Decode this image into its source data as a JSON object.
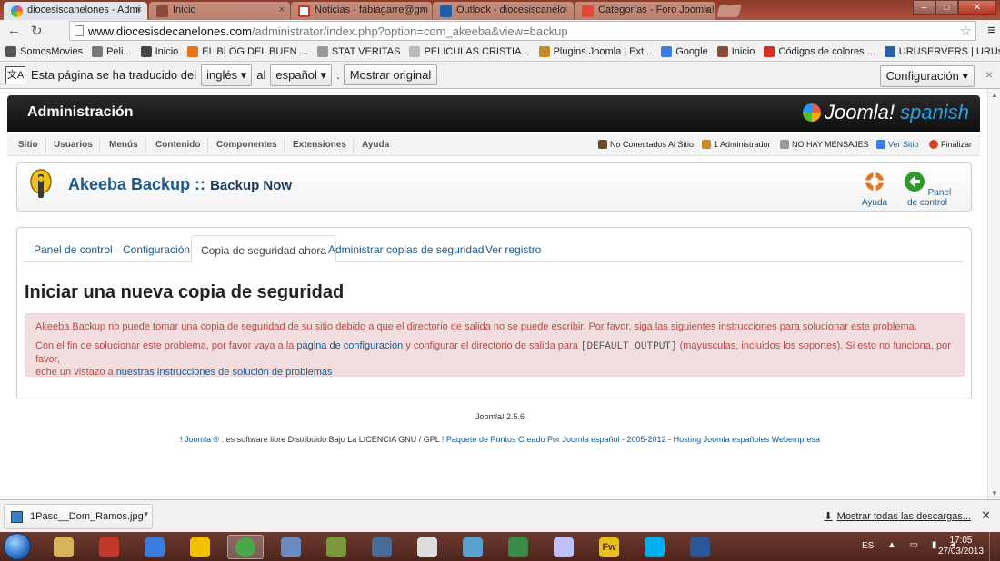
{
  "browser": {
    "tabs": [
      {
        "title": "diocesiscanelones - Admi",
        "close": "×",
        "color": "#2a6fc4"
      },
      {
        "title": "Inicio",
        "close": "×",
        "color": "#8b4a3a"
      },
      {
        "title": "Noticias - fabiagarre@gm",
        "close": "×",
        "color": "#d93025"
      },
      {
        "title": "Outlook - diocesiscanelo",
        "close": "×",
        "color": "#1f5fa8"
      },
      {
        "title": "Categorías - Foro Joomla!",
        "close": "×",
        "color": "#e04a3a"
      }
    ],
    "url_host": "www.diocesisdecanelones.com",
    "url_path": "/administrator/index.php?option=com_akeeba&view=backup",
    "back_icon": "←",
    "reload_icon": "↻",
    "star_icon": "☆",
    "menu_icon": "≡",
    "window_buttons": {
      "minimize": "–",
      "maximize": "□",
      "close": "✕"
    }
  },
  "bookmarks": [
    {
      "label": "SomosMovies",
      "color": "#555"
    },
    {
      "label": "Peli...",
      "color": "#777"
    },
    {
      "label": "Inicio",
      "color": "#444"
    },
    {
      "label": "EL BLOG DEL BUEN ...",
      "color": "#e8731a"
    },
    {
      "label": "STAT VERITAS",
      "color": "#999"
    },
    {
      "label": "PELICULAS CRISTIA...",
      "color": "#bbb"
    },
    {
      "label": "Plugins Joomla | Ext...",
      "color": "#c58a2a"
    },
    {
      "label": "Google",
      "color": "#3a7be0"
    },
    {
      "label": "Inicio",
      "color": "#8b4a3a"
    },
    {
      "label": "Códigos de colores ...",
      "color": "#d93025"
    },
    {
      "label": "URUSERVERS | URUs...",
      "color": "#2a5fa8"
    }
  ],
  "translate_bar": {
    "icon": "文A",
    "text_before": "Esta página se ha traducido del",
    "from_lang": "inglés ▾",
    "middle": "al",
    "to_lang": "español ▾",
    "dot": ".",
    "show_original": "Mostrar original",
    "config": "Configuración ▾",
    "close": "×"
  },
  "joomla": {
    "header_title": "Administración",
    "logo_text": "Joomla!",
    "logo_suffix": " spanish",
    "menu": [
      "Sitio",
      "Usuarios",
      "Menús",
      "Contenido",
      "Componentes",
      "Extensiones",
      "Ayuda"
    ],
    "status": {
      "visitors": "No Conectados Al Sitio",
      "admins": "1 Administrador",
      "messages": "NO HAY MENSAJES",
      "view_site": "Ver Sitio",
      "logout": "Finalizar"
    },
    "toolbar": {
      "title": "Akeeba Backup ::",
      "subtitle": "Backup Now",
      "help": "Ayuda",
      "control_panel": "Panel de control"
    },
    "tabs": [
      "Panel de control",
      "Configuración",
      "Copia de seguridad ahora",
      "Administrar copias de seguridad",
      "Ver registro"
    ],
    "heading": "Iniciar una nueva copia de seguridad",
    "alert": {
      "p1": "Akeeba Backup no puede tomar una copia de seguridad de su sitio debido a que el directorio de salida no se puede escribir. Por favor, siga las siguientes instrucciones para solucionar este problema.",
      "p2_a": "Con el fin de solucionar este problema, por favor vaya a la",
      "p2_link": "página de configuración",
      "p2_b": "y configurar el directorio de salida para",
      "p2_code": "[DEFAULT_OUTPUT]",
      "p2_c": "(mayúsculas, incluidos los soportes). Si esto no funciona, por favor,",
      "p2_d": "eche un vistazo a",
      "p2_link2": "nuestras instrucciones de solución de problemas"
    },
    "footer_version": "Joomla! 2.5.6",
    "footer_line": {
      "a": "! Joomla ®",
      "b": " . es software libre Distribuido Bajo La LICENCIA GNU / GPL ",
      "c": "! Paquete de Puntos Creado Por Joomla español - 2005-2012 - Hosting Joomla españoles Webempresa"
    }
  },
  "downloads": {
    "file": "1Pasc__Dom_Ramos.jpg",
    "arrow": "▾",
    "show_all": "Mostrar todas las descargas...",
    "dl_icon": "⬇",
    "close": "✕"
  },
  "taskbar": {
    "apps": [
      {
        "name": "explorer",
        "color": "#d9b35a"
      },
      {
        "name": "app2",
        "color": "#c0392b"
      },
      {
        "name": "app3",
        "color": "#3a7be0"
      },
      {
        "name": "app4",
        "color": "#f2c200"
      },
      {
        "name": "chrome",
        "color": "#4aa84a"
      },
      {
        "name": "app6",
        "color": "#6b8bbf"
      },
      {
        "name": "app7",
        "color": "#7a9a3a"
      },
      {
        "name": "app8",
        "color": "#4a6a9a"
      },
      {
        "name": "app9",
        "color": "#ddd"
      },
      {
        "name": "app10",
        "color": "#5aa0d0"
      },
      {
        "name": "app11",
        "color": "#3a8a4a"
      },
      {
        "name": "picasa",
        "color": "#c0c0ff"
      },
      {
        "name": "fireworks",
        "color": "#e8c020"
      },
      {
        "name": "skype",
        "color": "#00aff0"
      },
      {
        "name": "word",
        "color": "#2b579a"
      }
    ],
    "fw_label": "Fw",
    "lang": "ES",
    "tray_icons": "▲ ▭ ▮ ◂",
    "time": "17:05",
    "date": "27/03/2013"
  }
}
